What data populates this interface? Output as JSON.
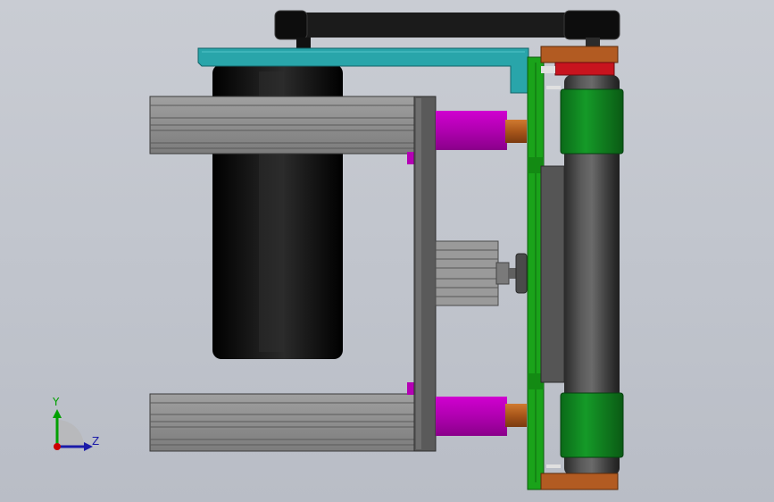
{
  "view": {
    "type": "CAD side view",
    "background": "#c3c7cf"
  },
  "triad": {
    "y_label": "Y",
    "z_label": "Z",
    "y_color": "#00a000",
    "z_color": "#1a1aa8",
    "x_color": "#cc0000"
  },
  "colors": {
    "belt": "#1b1b1b",
    "bracket": "#29a5aa",
    "motor": "#050505",
    "extrusion": "#8f8f8f",
    "plate": "#5a5a5a",
    "coupler": "#b400b4",
    "bushing": "#b0601a",
    "pcb_board": "#1aa31a",
    "roller": "#3c3c3c",
    "roller_sleeve": "#0e7d1e",
    "end_block": "#b25b22",
    "red_part": "#c8141e"
  }
}
